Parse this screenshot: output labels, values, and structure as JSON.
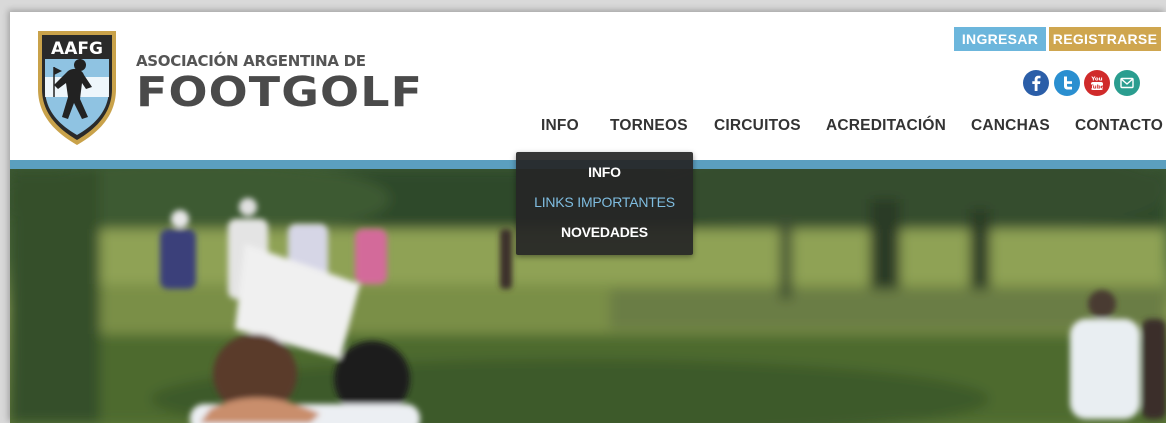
{
  "logo": {
    "badge_text": "AAFG",
    "line1": "ASOCIACIÓN ARGENTINA DE",
    "line2": "FOOTGOLF"
  },
  "auth": {
    "login_label": "INGRESAR",
    "register_label": "REGISTRARSE",
    "login_color": "#6cb6dc",
    "register_color": "#cfa64f"
  },
  "social": [
    {
      "name": "facebook-icon",
      "color": "#2b5ea8"
    },
    {
      "name": "twitter-icon",
      "color": "#2a8fd0"
    },
    {
      "name": "youtube-icon",
      "color": "#d02a2a"
    },
    {
      "name": "email-icon",
      "color": "#2a9d8f"
    }
  ],
  "nav": {
    "items": [
      "INFO",
      "TORNEOS",
      "CIRCUITOS",
      "ACREDITACIÓN",
      "CANCHAS",
      "CONTACTO"
    ]
  },
  "dropdown": {
    "items": [
      "INFO",
      "LINKS IMPORTANTES",
      "NOVEDADES"
    ],
    "active_index": 1
  },
  "colors": {
    "accent_bar": "#5b9fbf"
  }
}
